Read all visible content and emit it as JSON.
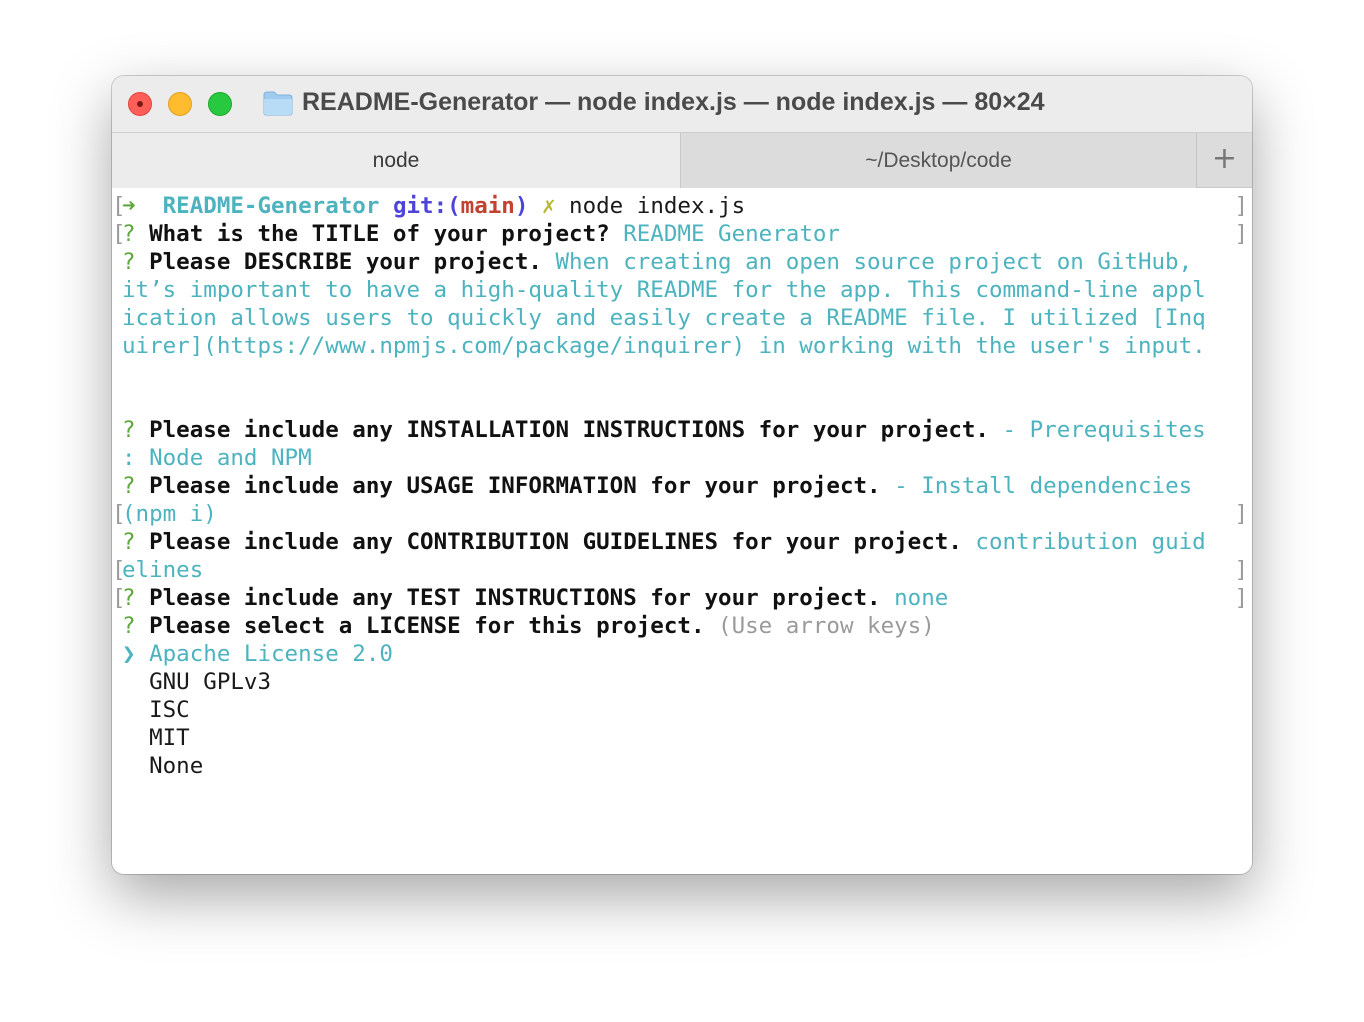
{
  "window": {
    "title": "README-Generator — node index.js — node index.js — 80×24"
  },
  "tabs": [
    {
      "label": "node"
    },
    {
      "label": "~/Desktop/code"
    }
  ],
  "add_tab_symbol": "+",
  "prompt": {
    "arrow": "➜",
    "dir": "README-Generator",
    "git_prefix": "git:(",
    "branch": "main",
    "git_suffix": ")",
    "dirty_mark": "✗",
    "command": "node index.js"
  },
  "questions": {
    "mark": "?",
    "title_q": "What is the TITLE of your project?",
    "title_a": "README Generator",
    "desc_q": "Please DESCRIBE your project.",
    "desc_a1": "When creating an open source project on GitHub,",
    "desc_a2": "it’s important to have a high-quality README for the app. This command-line appl",
    "desc_a3": "ication allows users to quickly and easily create a README file. I utilized [Inq",
    "desc_a4": "uirer](https://www.npmjs.com/package/inquirer) in working with the user's input.",
    "install_q": "Please include any INSTALLATION INSTRUCTIONS for your project.",
    "install_a1": "- Prerequisites",
    "install_a2": ": Node and NPM",
    "usage_q": "Please include any USAGE INFORMATION for your project.",
    "usage_a1": "- Install dependencies",
    "usage_a2": "(npm i)",
    "contrib_q": "Please include any CONTRIBUTION GUIDELINES for your project.",
    "contrib_a1": "contribution guid",
    "contrib_a2": "elines",
    "test_q": "Please include any TEST INSTRUCTIONS for your project.",
    "test_a": "none",
    "license_q": "Please select a LICENSE for this project.",
    "license_hint": "(Use arrow keys)"
  },
  "license_list": {
    "pointer": "❯",
    "selected": "Apache License 2.0",
    "options": [
      "GNU GPLv3",
      "ISC",
      "MIT",
      "None"
    ]
  }
}
